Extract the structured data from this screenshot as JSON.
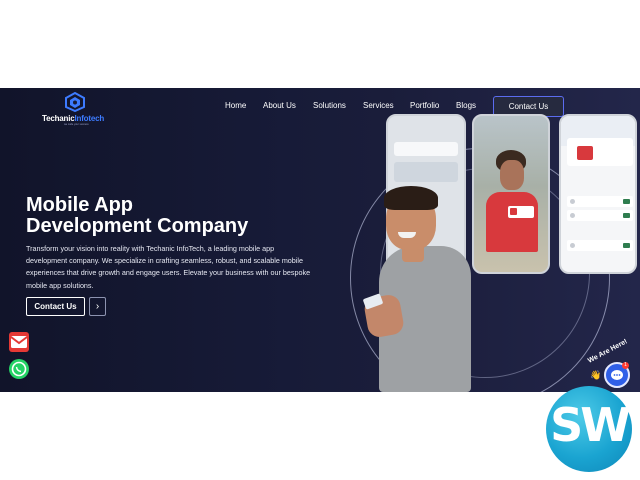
{
  "brand": {
    "name_part1": "Techanic",
    "name_part2": "Infotech",
    "tagline": "we code your success"
  },
  "nav": {
    "items": [
      "Home",
      "About Us",
      "Solutions",
      "Services",
      "Portfolio",
      "Blogs"
    ],
    "cta_label": "Contact Us"
  },
  "hero": {
    "title_line1": "Mobile App",
    "title_line2": "Development Company",
    "description": "Transform your vision into reality with Techanic InfoTech, a leading mobile app development company. We specialize in crafting seamless, robust, and scalable mobile experiences that drive growth and engage users. Elevate your business with our bespoke mobile app solutions.",
    "cta_label": "Contact Us",
    "arrow_glyph": "›"
  },
  "chat_widget": {
    "label": "We Are Here!",
    "badge": "1",
    "wave_glyph": "👋"
  },
  "watermark": {
    "text": "SW"
  },
  "colors": {
    "hero_bg": "#171b38",
    "accent": "#3d7bff",
    "cta_border": "#5b6cf0",
    "watermark": "#1aa4d1"
  },
  "icons": [
    "logo-icon",
    "gmail-icon",
    "whatsapp-icon",
    "chat-icon",
    "chevron-right-icon"
  ]
}
